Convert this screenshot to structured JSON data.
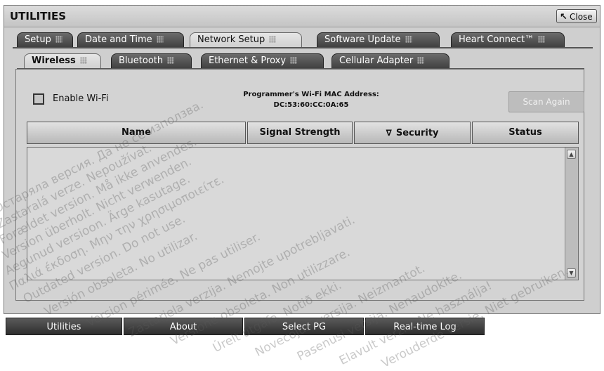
{
  "window": {
    "title": "UTILITIES",
    "close_label": "Close"
  },
  "main_tabs": [
    {
      "label": "Setup",
      "active": false
    },
    {
      "label": "Date and Time",
      "active": false
    },
    {
      "label": "Network Setup",
      "active": true
    },
    {
      "label": "Software Update",
      "active": false
    },
    {
      "label": "Heart Connect™",
      "active": false
    }
  ],
  "sub_tabs": [
    {
      "label": "Wireless",
      "active": true
    },
    {
      "label": "Bluetooth",
      "active": false
    },
    {
      "label": "Ethernet & Proxy",
      "active": false
    },
    {
      "label": "Cellular Adapter",
      "active": false
    }
  ],
  "wireless": {
    "enable_label": "Enable Wi-Fi",
    "enabled": false,
    "mac_title": "Programmer's Wi-Fi MAC Address:",
    "mac_value": "DC:53:60:CC:0A:65",
    "scan_label": "Scan Again",
    "scan_enabled": false,
    "columns": [
      "Name",
      "Signal Strength",
      "Security",
      "Status"
    ],
    "sort_column": "Security",
    "rows": []
  },
  "bottom_nav": [
    "Utilities",
    "About",
    "Select PG",
    "Real-time Log"
  ],
  "watermarks": [
    "Остаряла версия. Да не се използва.",
    "Zastaralá verze. Nepoužívat.",
    "Forældet version. Må ikke anvendes.",
    "Version überholt. Nicht verwenden.",
    "Aegunud versioon. Ärge kasutage.",
    "Παλιά έκδοση. Μην την χρησιμοποιείτε.",
    "Outdated version. Do not use.",
    "Versión obsoleta. No utilizar.",
    "Version périmée. Ne pas utiliser.",
    "Zastarjela verzija. Nemojte upotrebljavati.",
    "Versione obsoleta. Non utilizzare.",
    "Úrelt útgáfa. Notið ekki.",
    "Novecojusi versija. Neizmantot.",
    "Pasenusi versija. Nenaudokite.",
    "Elavult verzió. Ne használja!",
    "Verouderde versie. Niet gebruiken."
  ],
  "colors": {
    "tab_dark": "#4a4a4a",
    "panel_bg": "#d3d3d3",
    "window_bg": "#cfcfcf"
  }
}
